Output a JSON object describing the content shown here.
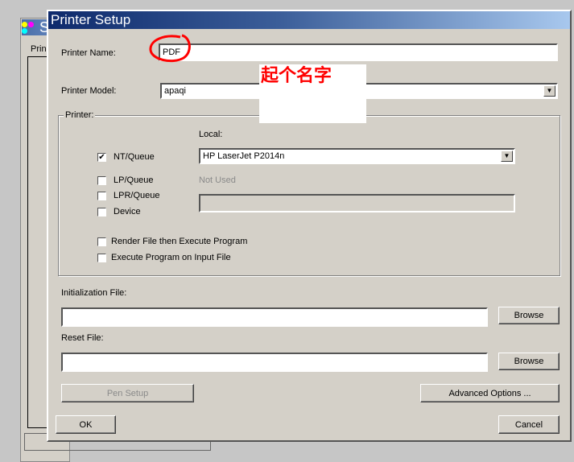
{
  "background_window": {
    "title": "S",
    "tab": "Prin"
  },
  "dialog": {
    "title": "Printer Setup"
  },
  "printer_name": {
    "label": "Printer Name:",
    "value": "PDF"
  },
  "printer_model": {
    "label": "Printer Model:",
    "value": "apaqi"
  },
  "annotation": {
    "text": "起个名字",
    "color": "#ff0000"
  },
  "printer_group": {
    "legend": "Printer:",
    "local_label": "Local:",
    "local_value": "HP LaserJet P2014n",
    "not_used_label": "Not Used",
    "options": [
      {
        "label": "NT/Queue",
        "checked": true
      },
      {
        "label": "LP/Queue",
        "checked": false
      },
      {
        "label": "LPR/Queue",
        "checked": false
      },
      {
        "label": "Device",
        "checked": false
      }
    ],
    "render_option": {
      "label": "Render File then Execute Program",
      "checked": false
    },
    "execute_option": {
      "label": "Execute Program on Input File",
      "checked": false
    }
  },
  "init_file": {
    "label": "Initialization File:",
    "value": "",
    "browse": "Browse"
  },
  "reset_file": {
    "label": "Reset File:",
    "value": "",
    "browse": "Browse"
  },
  "buttons": {
    "pen_setup": "Pen Setup",
    "advanced": "Advanced Options ...",
    "ok": "OK",
    "cancel": "Cancel"
  }
}
